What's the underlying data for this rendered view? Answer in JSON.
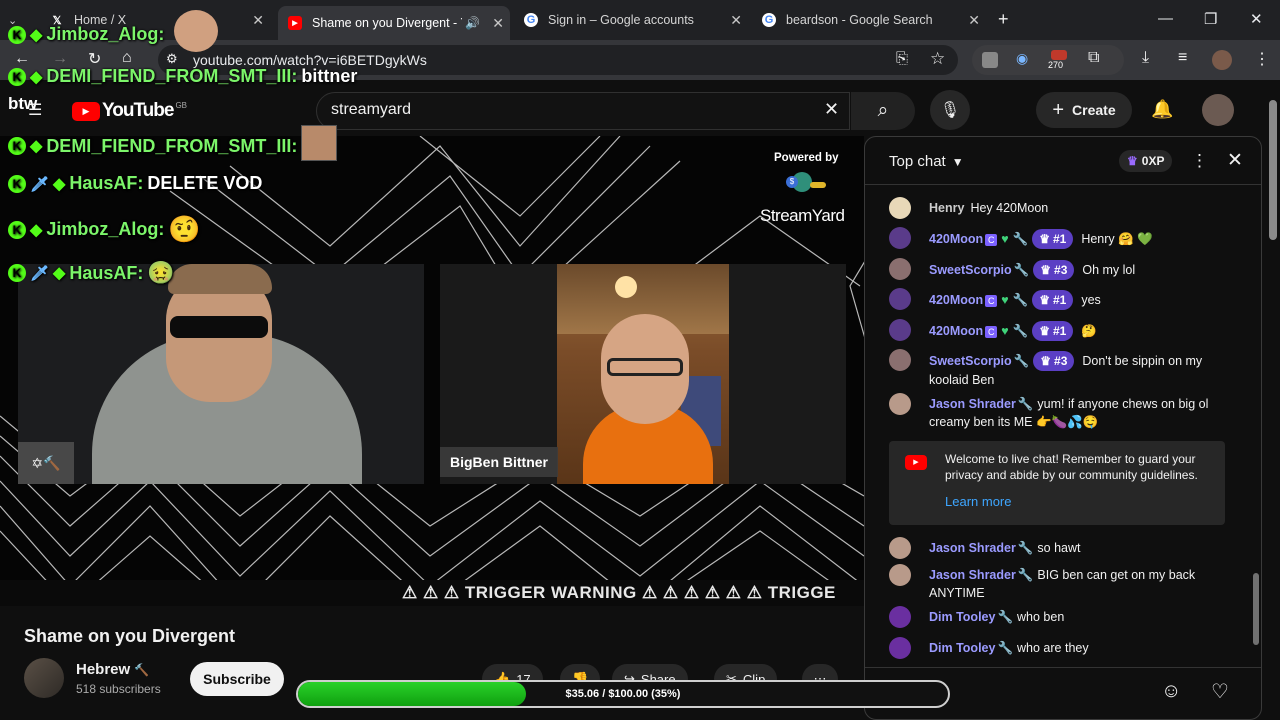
{
  "browser": {
    "tabs": [
      {
        "label": "Home / X",
        "icon": "x-logo-icon"
      },
      {
        "label": "Shame on you Divergent - Y",
        "icon": "youtube-icon",
        "active": true
      },
      {
        "label": "Sign in – Google accounts",
        "icon": "google-icon"
      },
      {
        "label": "beardson - Google Search",
        "icon": "google-icon"
      }
    ],
    "url": "youtube.com/watch?v=i6BETDgykWs",
    "ext_badge": "270"
  },
  "youtube": {
    "logo": "YouTube",
    "region": "GB",
    "search_value": "streamyard",
    "create_label": "Create"
  },
  "overlay": {
    "brand": "btw",
    "streamyard_powered": "Powered by",
    "streamyard_name": "StreamYard",
    "chat": [
      {
        "user": "Jimboz_Alog:",
        "msg": ""
      },
      {
        "user": "DEMI_FIEND_FROM_SMT_III:",
        "msg": "bittner"
      },
      {
        "user": "DEMI_FIEND_FROM_SMT_III:",
        "msg": ""
      },
      {
        "user": "HausAF:",
        "msg": "DELETE VOD"
      },
      {
        "user": "Jimboz_Alog:",
        "msg": ""
      },
      {
        "user": "HausAF:",
        "msg": ""
      }
    ],
    "cam2_name": "BigBen Bittner",
    "ticker": "⚠ ⚠ ⚠ TRIGGER WARNING ⚠ ⚠ ⚠ ⚠ ⚠ ⚠ TRIGGE"
  },
  "chat": {
    "mode": "Top chat",
    "xp": "0XP",
    "messages": [
      {
        "author": "Henry",
        "text": "Hey 420Moon",
        "badges": []
      },
      {
        "author": "420Moon",
        "rank": "#1",
        "text": "Henry 🤗 💚"
      },
      {
        "author": "SweetScorpio",
        "rank": "#3",
        "text": "Oh my lol"
      },
      {
        "author": "420Moon",
        "rank": "#1",
        "text": "yes"
      },
      {
        "author": "420Moon",
        "rank": "#1",
        "text": "🤔"
      },
      {
        "author": "SweetScorpio",
        "rank": "#3",
        "text": "Don't be sippin on my koolaid Ben"
      },
      {
        "author": "Jason Shrader",
        "text": "yum! if anyone chews on big ol creamy ben its ME 👉🍆💦🤤"
      },
      {
        "author": "Jason Shrader",
        "text": "so hawt"
      },
      {
        "author": "Jason Shrader",
        "text": "BIG ben can get on my back ANYTIME"
      },
      {
        "author": "Dim Tooley",
        "text": "who ben"
      },
      {
        "author": "Dim Tooley",
        "text": "who are they"
      }
    ],
    "notice": {
      "text": "Welcome to live chat! Remember to guard your privacy and abide by our community guidelines.",
      "link": "Learn more"
    }
  },
  "video": {
    "title": "Shame on you Divergent",
    "channel": "Hebrew",
    "subscribers": "518 subscribers",
    "subscribe_label": "Subscribe",
    "likes": "17",
    "share_label": "Share",
    "clip_label": "Clip"
  },
  "goal": {
    "text": "$35.06 / $100.00 (35%)",
    "fraction": 0.35
  }
}
